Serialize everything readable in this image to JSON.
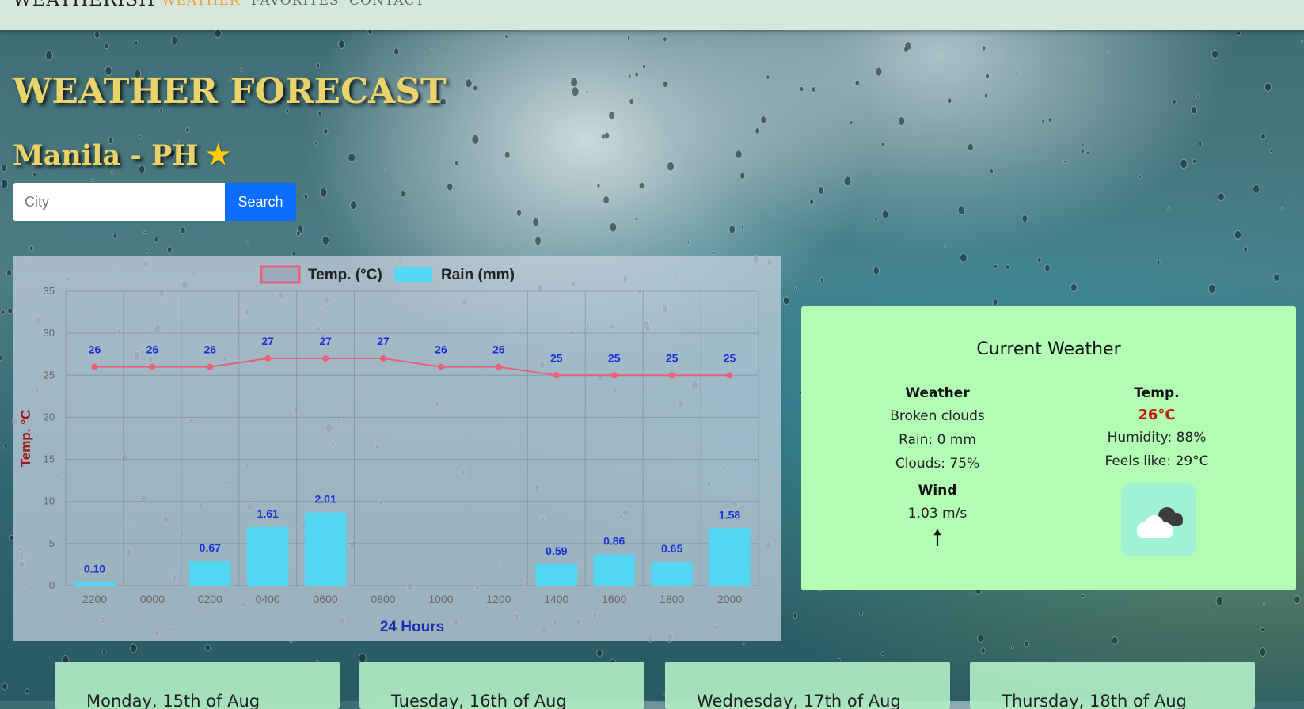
{
  "nav": {
    "brand": "WEATHERISH",
    "links": [
      {
        "label": "WEATHER",
        "active": true
      },
      {
        "label": "FAVORITES",
        "active": false
      },
      {
        "label": "CONTACT",
        "active": false
      }
    ]
  },
  "header": {
    "title": "WEATHER FORECAST",
    "city": "Manila - PH",
    "favorite_icon": "star-icon"
  },
  "search": {
    "placeholder": "City",
    "value": "",
    "button_label": "Search"
  },
  "chart_data": {
    "type": "bar",
    "categories": [
      "2200",
      "0000",
      "0200",
      "0400",
      "0600",
      "0800",
      "1000",
      "1200",
      "1400",
      "1600",
      "1800",
      "2000"
    ],
    "series": [
      {
        "name": "Temp. (°C)",
        "type": "line",
        "color": "#e8607a",
        "values": [
          26,
          26,
          26,
          27,
          27,
          27,
          26,
          26,
          25,
          25,
          25,
          25
        ],
        "labels": [
          "26",
          "26",
          "26",
          "27",
          "27",
          "27",
          "26",
          "26",
          "25",
          "25",
          "25",
          "25"
        ]
      },
      {
        "name": "Rain (mm)",
        "type": "bar",
        "color": "#55d6f2",
        "values": [
          0.1,
          0,
          0.67,
          1.61,
          2.01,
          0,
          0,
          0,
          0.59,
          0.86,
          0.65,
          1.58
        ],
        "labels": [
          "0.10",
          "",
          "0.67",
          "1.61",
          "2.01",
          "",
          "",
          "",
          "0.59",
          "0.86",
          "0.65",
          "1.58"
        ]
      }
    ],
    "xlabel": "24 Hours",
    "ylabel": "Temp. °C",
    "ylim": [
      0,
      35
    ],
    "yticks": [
      0,
      5,
      10,
      15,
      20,
      25,
      30,
      35
    ],
    "grid": true,
    "legend_position": "top-center"
  },
  "current": {
    "title": "Current Weather",
    "weather_label": "Weather",
    "description": "Broken clouds",
    "rain": "Rain: 0 mm",
    "clouds": "Clouds: 75%",
    "wind_label": "Wind",
    "wind_speed": "1.03 m/s",
    "wind_icon": "wind-direction-arrow-icon",
    "temp_label": "Temp.",
    "temp": "26°C",
    "humidity": "Humidity: 88%",
    "feels_like": "Feels like: 29°C",
    "weather_icon": "broken-clouds-icon"
  },
  "forecast": [
    {
      "date": "Monday, 15th of Aug"
    },
    {
      "date": "Tuesday, 16th of Aug"
    },
    {
      "date": "Wednesday, 17th of Aug"
    },
    {
      "date": "Thursday, 18th of Aug"
    }
  ]
}
